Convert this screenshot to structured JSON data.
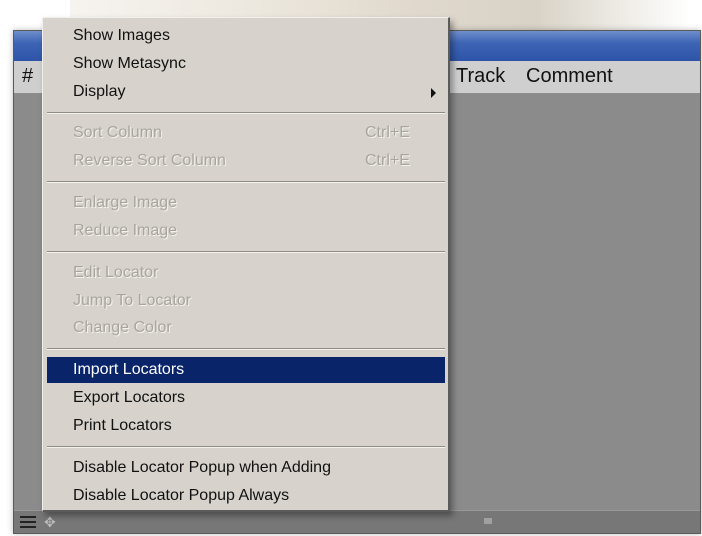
{
  "table_header": {
    "col_number": "#",
    "col_track": "Track",
    "col_comment": "Comment"
  },
  "menu": {
    "items": [
      {
        "label": "Show Images",
        "enabled": true
      },
      {
        "label": "Show Metasync",
        "enabled": true
      },
      {
        "label": "Display",
        "enabled": true,
        "submenu": true
      },
      {
        "label": "Sort Column",
        "shortcut": "Ctrl+E",
        "enabled": false
      },
      {
        "label": "Reverse Sort Column",
        "shortcut": "Ctrl+E",
        "enabled": false
      },
      {
        "label": "Enlarge Image",
        "enabled": false
      },
      {
        "label": "Reduce Image",
        "enabled": false
      },
      {
        "label": "Edit Locator",
        "enabled": false
      },
      {
        "label": "Jump To Locator",
        "enabled": false
      },
      {
        "label": "Change Color",
        "enabled": false
      },
      {
        "label": "Import Locators",
        "enabled": true,
        "highlighted": true
      },
      {
        "label": "Export Locators",
        "enabled": true
      },
      {
        "label": "Print Locators",
        "enabled": true
      },
      {
        "label": "Disable Locator Popup when Adding",
        "enabled": true
      },
      {
        "label": "Disable Locator Popup Always",
        "enabled": true
      }
    ]
  },
  "colors": {
    "menu_background": "#d7d3cc",
    "highlight": "#0a246a",
    "titlebar": "#2d54a8",
    "list_background": "#8b8b8b"
  }
}
